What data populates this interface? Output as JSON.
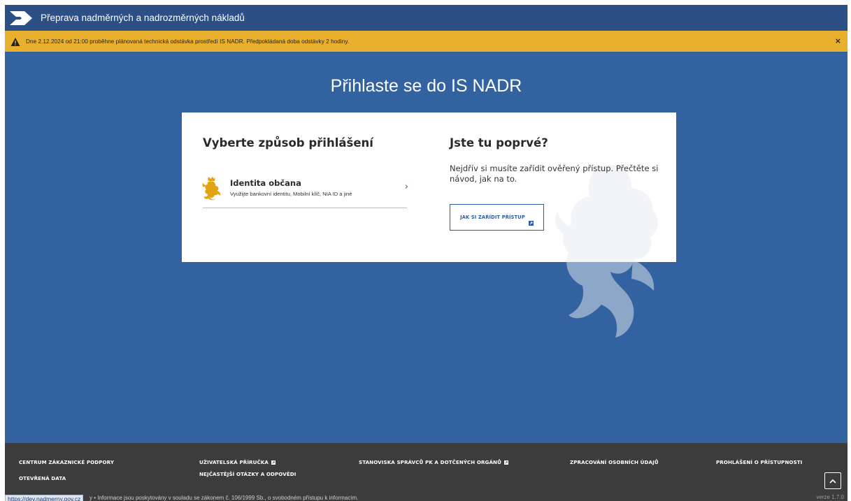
{
  "header": {
    "title": "Přeprava nadměrných a nadrozměrných nákladů",
    "logo_icon": "arrow-chevron-logo-icon"
  },
  "alert": {
    "text": "Dne 2.12.2024 od 21:00 proběhne plánovaná technická odstávka prostředí IS NADR. Předpokládaná doba odstávky 2 hodiny.",
    "close_label": "×",
    "icon": "warning-icon",
    "color": "#e8b02c"
  },
  "page": {
    "title": "Přihlaste se do IS NADR",
    "background_color": "#3362a1"
  },
  "login": {
    "heading": "Vyberte způsob přihlášení",
    "identity": {
      "title": "Identita občana",
      "subtitle": "Využijte bankovní identitu, Mobilní klíč, NIA ID a jiné",
      "chevron": "›",
      "icon": "czech-lion-emblem-icon"
    }
  },
  "first_time": {
    "heading": "Jste tu poprvé?",
    "text": "Nejdřív si musíte zařídit ověřený přístup. Přečtěte si návod, jak na to.",
    "button_label": "JAK SI ZAŘÍDIT PŘÍSTUP"
  },
  "footer": {
    "links": {
      "support": "CENTRUM ZÁKAZNICKÉ PODPORY",
      "open_data": "OTEVŘENÁ DATA",
      "manual": "UŽIVATELSKÁ PŘÍRUČKA",
      "faq": "NEJČASTĚJŠÍ OTÁZKY A ODPOVĚDI",
      "opinions": "STANOVISKA SPRÁVCŮ PK A DOTČENÝCH ORGÁNŮ",
      "privacy": "ZPRACOVÁNÍ OSOBNÍCH ÚDAJŮ",
      "accessibility": "PROHLÁŠENÍ O PŘÍSTUPNOSTI"
    },
    "note": "y • Informace jsou poskytovány v souladu se zákonem č. 106/1999 Sb., o svobodném přístupu k informacím.",
    "url_tooltip": "https://dev.nadmerny.gov.cz",
    "version": "verze 1.7.0",
    "scroll_top_icon": "chevron-up-icon"
  }
}
